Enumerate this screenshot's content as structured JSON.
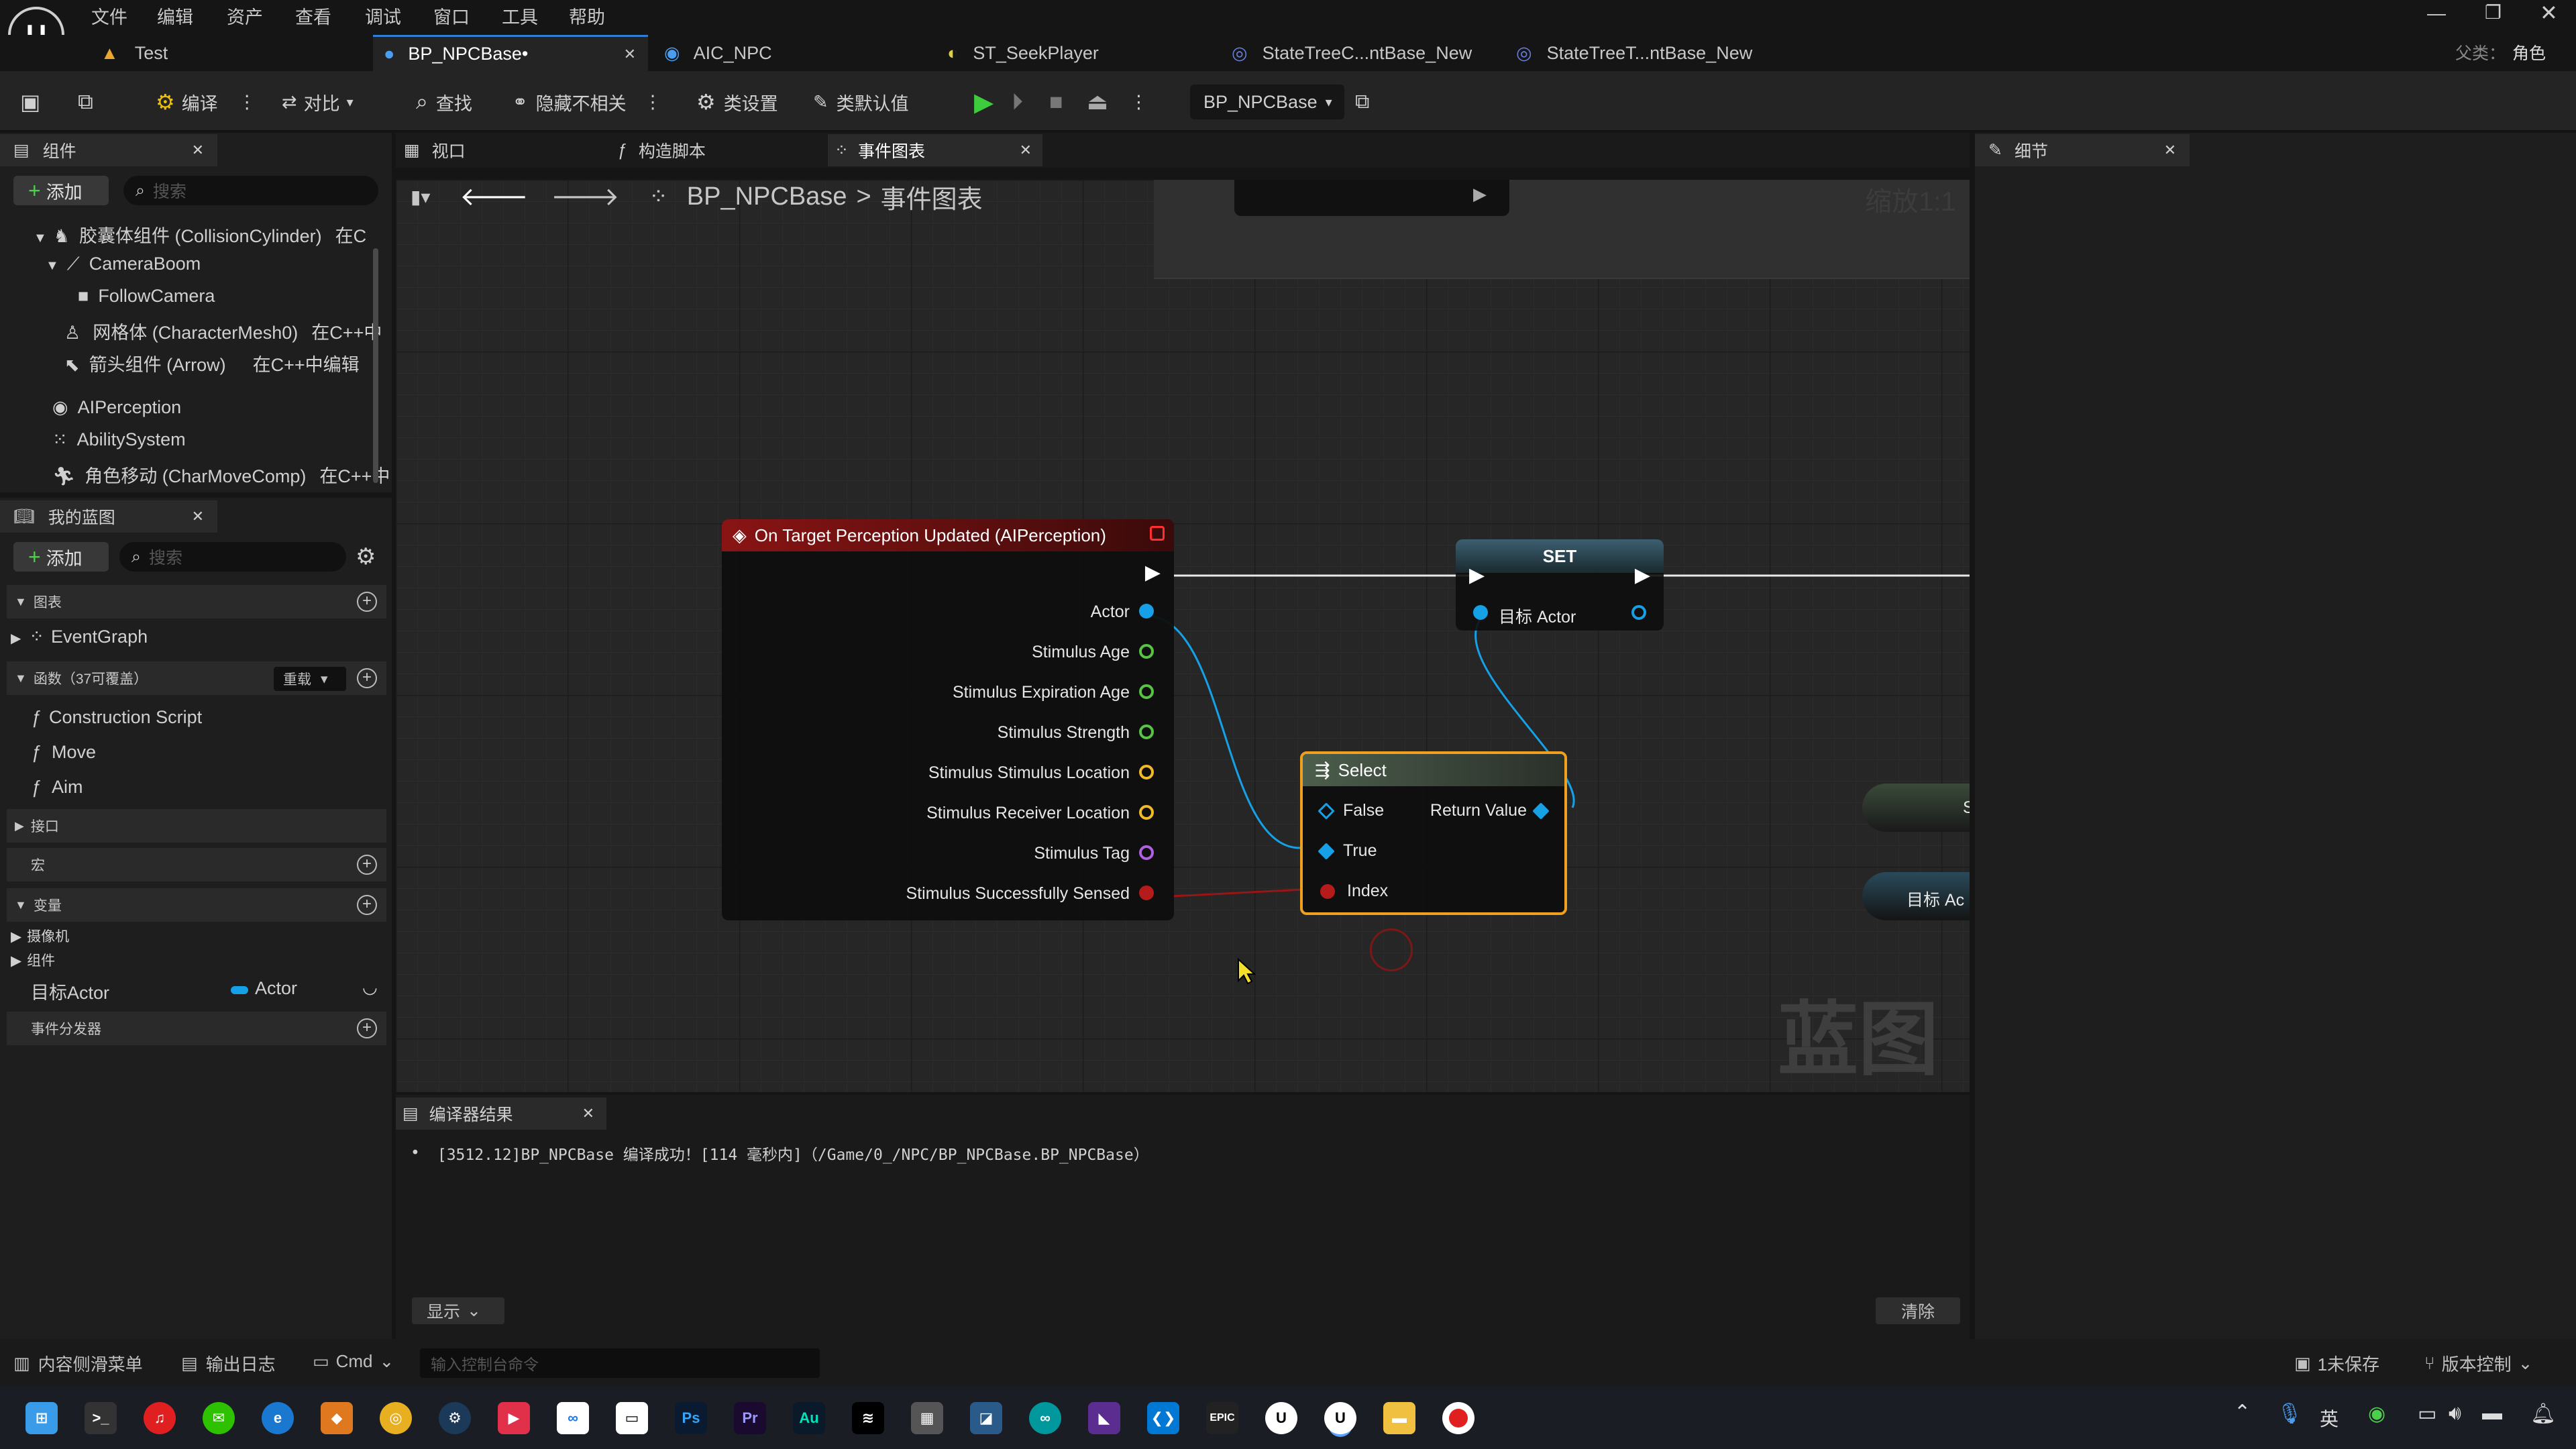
{
  "menu": [
    "文件",
    "编辑",
    "资产",
    "查看",
    "调试",
    "窗口",
    "工具",
    "帮助"
  ],
  "tabs": [
    {
      "label": "Test"
    },
    {
      "label": "BP_NPCBase•"
    },
    {
      "label": "AIC_NPC"
    },
    {
      "label": "ST_SeekPlayer"
    },
    {
      "label": "StateTreeC...ntBase_New"
    },
    {
      "label": "StateTreeT...ntBase_New"
    }
  ],
  "parent": {
    "label": "父类：",
    "value": "角色"
  },
  "toolbar": {
    "compile": "编译",
    "diff": "对比",
    "find": "查找",
    "hide_unrelated": "隐藏不相关",
    "class_settings": "类设置",
    "class_defaults": "类默认值",
    "debug_target": "BP_NPCBase"
  },
  "components": {
    "tab": "组件",
    "add": "添加",
    "search_placeholder": "搜索",
    "items": [
      {
        "label": "胶囊体组件 (CollisionCylinder)",
        "suffix": "在C"
      },
      {
        "label": "CameraBoom",
        "suffix": ""
      },
      {
        "label": "FollowCamera",
        "suffix": ""
      },
      {
        "label": "网格体 (CharacterMesh0)",
        "suffix": "在C++中"
      },
      {
        "label": "箭头组件 (Arrow)",
        "suffix": "在C++中编辑"
      },
      {
        "label": "AIPerception",
        "suffix": ""
      },
      {
        "label": "AbilitySystem",
        "suffix": ""
      },
      {
        "label": "角色移动 (CharMoveComp)",
        "suffix": "在C++中"
      }
    ]
  },
  "my_blueprint": {
    "tab": "我的蓝图",
    "add": "添加",
    "search_placeholder": "搜索",
    "graphs_header": "图表",
    "event_graph": "EventGraph",
    "functions_header": "函数（37可覆盖）",
    "override": "重载",
    "functions": [
      "Construction Script",
      "Move",
      "Aim"
    ],
    "interfaces_header": "接口",
    "macros_header": "宏",
    "variables_header": "变量",
    "var_categories": [
      "摄像机",
      "组件"
    ],
    "variable": {
      "name": "目标Actor",
      "type": "Actor"
    },
    "dispatchers_header": "事件分发器"
  },
  "editor_tabs": {
    "viewport": "视口",
    "construction": "构造脚本",
    "event_graph": "事件图表"
  },
  "breadcrumb": {
    "root": "BP_NPCBase",
    "separator": ">",
    "current": "事件图表"
  },
  "zoom": "缩放1:1",
  "watermark": "蓝图",
  "nodes": {
    "event": {
      "title": "On Target Perception Updated (AIPerception)",
      "pins": [
        "Actor",
        "Stimulus Age",
        "Stimulus Expiration Age",
        "Stimulus Strength",
        "Stimulus Stimulus Location",
        "Stimulus Receiver Location",
        "Stimulus Tag",
        "Stimulus Successfully Sensed"
      ]
    },
    "set": {
      "title": "SET",
      "pin": "目标 Actor"
    },
    "select": {
      "title": "Select",
      "pins": [
        "False",
        "True",
        "Index"
      ],
      "output": "Return Value"
    },
    "right1": "S",
    "right2": "目标 Ac"
  },
  "compiler": {
    "tab": "编译器结果",
    "message": "[3512.12]BP_NPCBase 编译成功！[114 毫秒内]（/Game/0_/NPC/BP_NPCBase.BP_NPCBase）",
    "show": "显示",
    "clear": "清除"
  },
  "details": {
    "tab": "细节"
  },
  "status": {
    "content_drawer": "内容侧滑菜单",
    "output_log": "输出日志",
    "cmd": "Cmd",
    "console_placeholder": "输入控制台命令",
    "unsaved": "1未保存",
    "source_control": "版本控制"
  },
  "taskbar": {
    "ime": "英"
  },
  "colors": {
    "accent": "#2f7fd6",
    "event_header": "#7a1515",
    "set_header": "#2a4a5a",
    "select_header": "#3e5040",
    "select_border": "#f0a020",
    "object_pin": "#16a0e6",
    "float_pin": "#57c443",
    "vector_pin": "#f2b928",
    "tag_pin": "#b060e0",
    "bool_pin": "#b51b1b"
  }
}
